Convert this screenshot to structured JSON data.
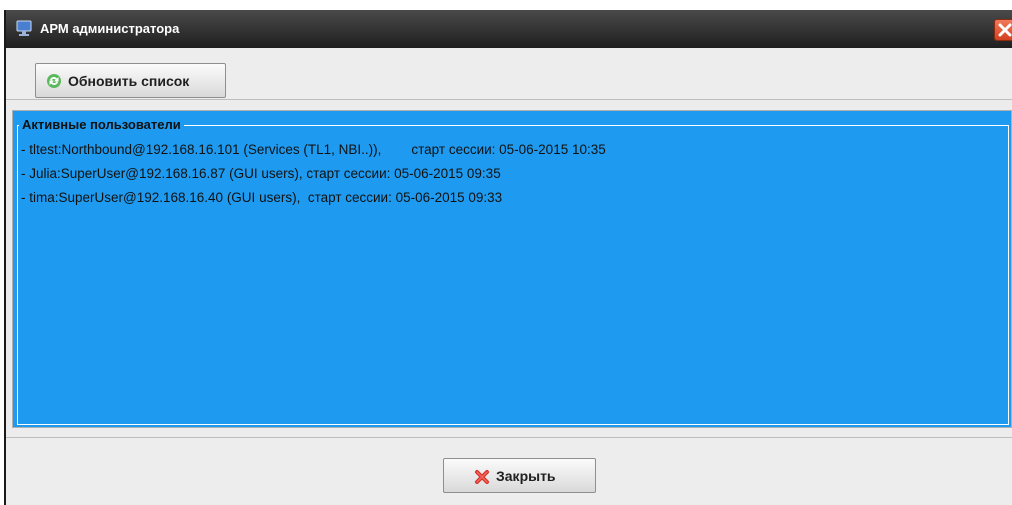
{
  "window": {
    "title": "АРМ администратора"
  },
  "toolbar": {
    "refresh_label": "Обновить список"
  },
  "panel": {
    "title": "Активные пользователи",
    "users": [
      "- tltest:Northbound@192.168.16.101 (Services (TL1, NBI..)),        старт сессии: 05-06-2015 10:35",
      "- Julia:SuperUser@192.168.16.87 (GUI users), старт сессии: 05-06-2015 09:35",
      "- tima:SuperUser@192.168.16.40 (GUI users),  старт сессии: 05-06-2015 09:33"
    ]
  },
  "footer": {
    "close_label": "Закрыть"
  },
  "colors": {
    "panel_bg": "#1e9bf0",
    "titlebar_bg": "#2a2a2a",
    "close_button_red": "#d3401f"
  },
  "icons": {
    "title": "monitor-icon",
    "close_window": "close-icon",
    "refresh": "refresh-icon",
    "close_button": "red-x-icon"
  }
}
